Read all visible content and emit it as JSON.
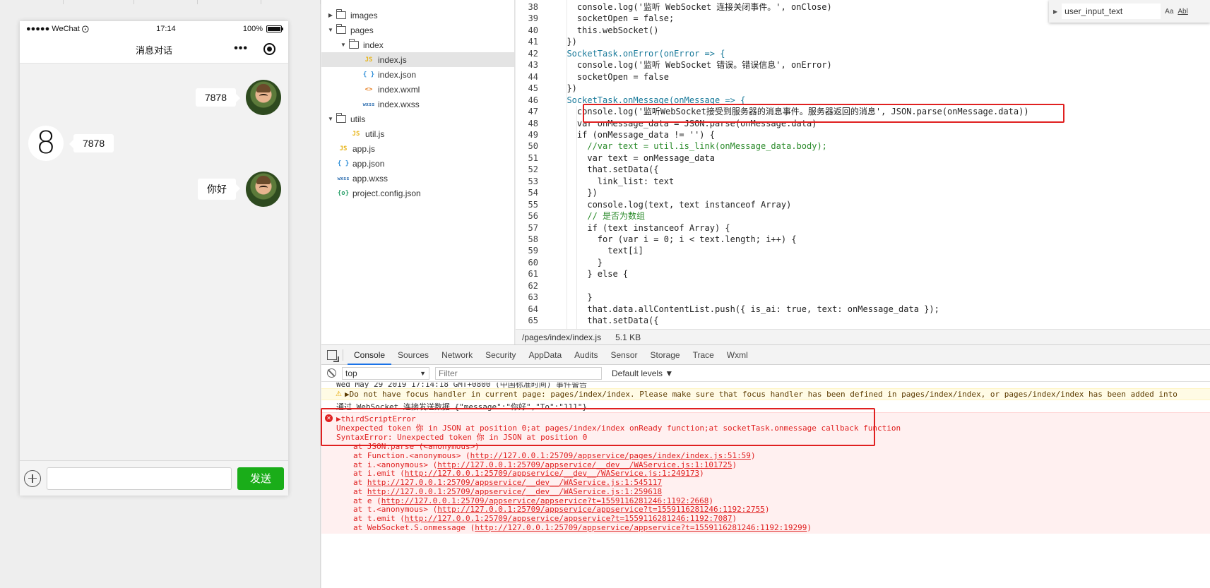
{
  "simulator": {
    "statusbar": {
      "carrier": "●●●●● WeChat",
      "time": "17:14",
      "battery": "100%"
    },
    "navbar": {
      "title": "消息对话"
    },
    "messages": [
      {
        "side": "right",
        "text": "7878"
      },
      {
        "side": "left",
        "text": "7878",
        "avatar_char": "8"
      },
      {
        "side": "right",
        "text": "你好"
      }
    ],
    "input": {
      "value": "",
      "placeholder": ""
    },
    "send_label": "发送"
  },
  "filetree": {
    "items": [
      {
        "name": "images",
        "type": "folder",
        "depth": 0,
        "expanded": false
      },
      {
        "name": "pages",
        "type": "folder",
        "depth": 0,
        "expanded": true
      },
      {
        "name": "index",
        "type": "folder",
        "depth": 1,
        "expanded": true
      },
      {
        "name": "index.js",
        "type": "js",
        "depth": 2,
        "selected": true
      },
      {
        "name": "index.json",
        "type": "json",
        "depth": 2
      },
      {
        "name": "index.wxml",
        "type": "wxml",
        "depth": 2
      },
      {
        "name": "index.wxss",
        "type": "wxss",
        "depth": 2
      },
      {
        "name": "utils",
        "type": "folder",
        "depth": 0,
        "expanded": true
      },
      {
        "name": "util.js",
        "type": "js",
        "depth": 1
      },
      {
        "name": "app.js",
        "type": "js",
        "depth": 0
      },
      {
        "name": "app.json",
        "type": "json",
        "depth": 0
      },
      {
        "name": "app.wxss",
        "type": "wxss",
        "depth": 0
      },
      {
        "name": "project.config.json",
        "type": "cfg",
        "depth": 0
      }
    ],
    "icons": {
      "js": "JS",
      "json": "{ }",
      "wxml": "<>",
      "wxss": "wxss",
      "cfg": "{o}"
    }
  },
  "editor": {
    "find": {
      "value": "user_input_text",
      "opt_case": "Aa",
      "opt_word": "Abl"
    },
    "lines": [
      {
        "n": "38",
        "code": "    console.log('监听 WebSocket 连接关闭事件。', onClose)"
      },
      {
        "n": "39",
        "code": "    socketOpen = false;"
      },
      {
        "n": "40",
        "code": "    this.webSocket()"
      },
      {
        "n": "41",
        "code": "  })"
      },
      {
        "n": "42",
        "code": "  SocketTask.onError(onError => {"
      },
      {
        "n": "43",
        "code": "    console.log('监听 WebSocket 错误。错误信息', onError)"
      },
      {
        "n": "44",
        "code": "    socketOpen = false"
      },
      {
        "n": "45",
        "code": "  })"
      },
      {
        "n": "46",
        "code": "  SocketTask.onMessage(onMessage => {"
      },
      {
        "n": "47",
        "code": "    console.log('监听WebSocket接受到服务器的消息事件。服务器返回的消息', JSON.parse(onMessage.data))"
      },
      {
        "n": "48",
        "code": "    var onMessage_data = JSON.parse(onMessage.data)"
      },
      {
        "n": "49",
        "code": "    if (onMessage_data != '') {"
      },
      {
        "n": "50",
        "code": "      //var text = util.is_link(onMessage_data.body);"
      },
      {
        "n": "51",
        "code": "      var text = onMessage_data"
      },
      {
        "n": "52",
        "code": "      that.setData({"
      },
      {
        "n": "53",
        "code": "        link_list: text"
      },
      {
        "n": "54",
        "code": "      })"
      },
      {
        "n": "55",
        "code": "      console.log(text, text instanceof Array)"
      },
      {
        "n": "56",
        "code": "      // 是否为数组"
      },
      {
        "n": "57",
        "code": "      if (text instanceof Array) {"
      },
      {
        "n": "58",
        "code": "        for (var i = 0; i < text.length; i++) {"
      },
      {
        "n": "59",
        "code": "          text[i]"
      },
      {
        "n": "60",
        "code": "        }"
      },
      {
        "n": "61",
        "code": "      } else {"
      },
      {
        "n": "62",
        "code": ""
      },
      {
        "n": "63",
        "code": "      }"
      },
      {
        "n": "64",
        "code": "      that.data.allContentList.push({ is_ai: true, text: onMessage_data });"
      },
      {
        "n": "65",
        "code": "      that.setData({"
      }
    ],
    "status": {
      "path": "/pages/index/index.js",
      "size": "5.1 KB"
    }
  },
  "devtools": {
    "tabs": [
      "Console",
      "Sources",
      "Network",
      "Security",
      "AppData",
      "Audits",
      "Sensor",
      "Storage",
      "Trace",
      "Wxml"
    ],
    "active_tab": "Console",
    "context": "top",
    "filter_placeholder": "Filter",
    "levels": "Default levels ▼",
    "console": {
      "top_partial": "Wed May 29 2019 17:14:18 GMT+0800 (中国标准时间) 事件警告",
      "warning": "▶Do not have focus handler in current page: pages/index/index. Please make sure that focus handler has been defined in pages/index/index, or pages/index/index has been added into",
      "sent": "通过 WebSocket 连接发送数据 {\"message\":\"你好\",\"To\":\"111\"}",
      "error_title": "▶thirdScriptError",
      "error_msg": "Unexpected token 你 in JSON at position 0;at pages/index/index onReady function;at socketTask.onmessage callback function",
      "syntax_error": "SyntaxError: Unexpected token 你 in JSON at position 0",
      "stack_first": "at JSON.parse (<anonymous>)",
      "stack": [
        {
          "pre": "at Function.<anonymous> (",
          "link": "http://127.0.0.1:25709/appservice/pages/index/index.js:51:59",
          "post": ")"
        },
        {
          "pre": "at i.<anonymous> (",
          "link": "http://127.0.0.1:25709/appservice/__dev__/WAService.js:1:101725",
          "post": ")"
        },
        {
          "pre": "at i.emit (",
          "link": "http://127.0.0.1:25709/appservice/__dev__/WAService.js:1:249173",
          "post": ")"
        },
        {
          "pre": "at ",
          "link": "http://127.0.0.1:25709/appservice/__dev__/WAService.js:1:545117",
          "post": ""
        },
        {
          "pre": "at ",
          "link": "http://127.0.0.1:25709/appservice/__dev__/WAService.js:1:259618",
          "post": ""
        },
        {
          "pre": "at e (",
          "link": "http://127.0.0.1:25709/appservice/appservice?t=1559116281246:1192:2668",
          "post": ")"
        },
        {
          "pre": "at t.<anonymous> (",
          "link": "http://127.0.0.1:25709/appservice/appservice?t=1559116281246:1192:2755",
          "post": ")"
        },
        {
          "pre": "at t.emit (",
          "link": "http://127.0.0.1:25709/appservice/appservice?t=1559116281246:1192:7087",
          "post": ")"
        },
        {
          "pre": "at WebSocket.S.onmessage (",
          "link": "http://127.0.0.1:25709/appservice/appservice?t=1559116281246:1192:19299",
          "post": ")"
        }
      ]
    }
  }
}
